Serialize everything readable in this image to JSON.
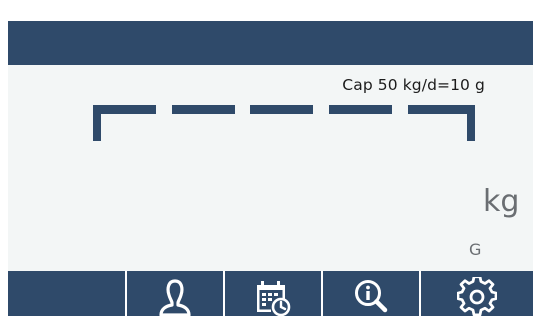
{
  "header": {
    "capacity_label": "Cap 50 kg/d=10 g",
    "bar_color": "#2f4a6a"
  },
  "weight_display": {
    "digits": "-----",
    "state": "under-range",
    "unit": "kg",
    "mode_indicator": "G"
  },
  "softkeys": [
    {
      "name": "blank",
      "icon": "none"
    },
    {
      "name": "user",
      "icon": "user-icon"
    },
    {
      "name": "calendar",
      "icon": "calendar-clock-icon"
    },
    {
      "name": "information",
      "icon": "info-magnifier-icon"
    },
    {
      "name": "settings",
      "icon": "gear-icon"
    }
  ],
  "colors": {
    "accent": "#2f4a6a",
    "display_bg": "#f3f6f6",
    "unit_text": "#6a6e72"
  }
}
